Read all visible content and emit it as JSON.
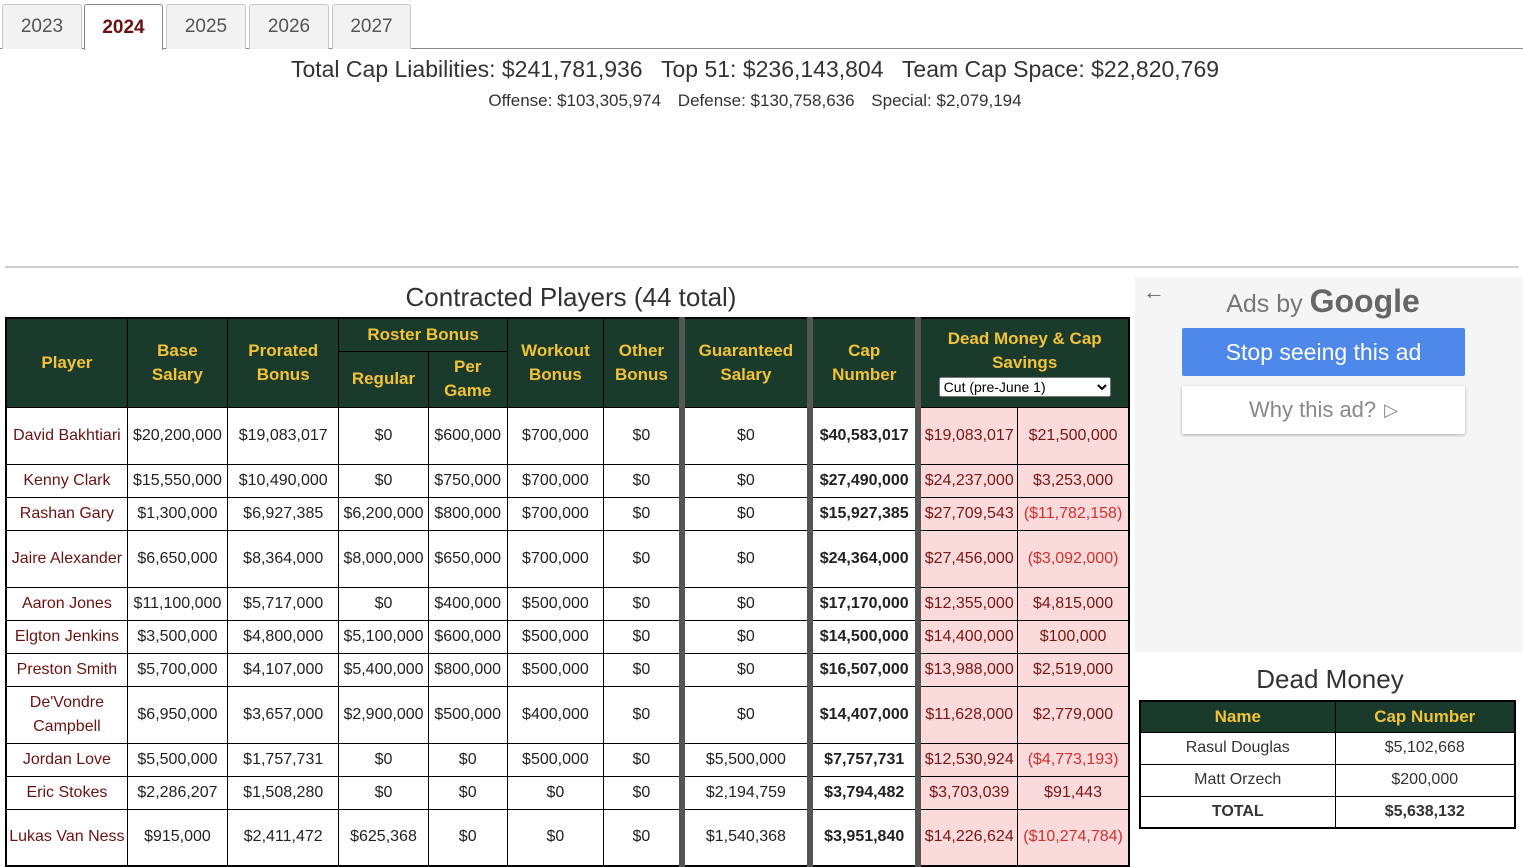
{
  "tabs": [
    {
      "label": "2023",
      "active": false
    },
    {
      "label": "2024",
      "active": true
    },
    {
      "label": "2025",
      "active": false
    },
    {
      "label": "2026",
      "active": false
    },
    {
      "label": "2027",
      "active": false
    }
  ],
  "summary": {
    "total_cap_liabilities": "Total Cap Liabilities: $241,781,936",
    "top_51": "Top 51: $236,143,804",
    "team_cap_space": "Team Cap Space: $22,820,769",
    "offense": "Offense: $103,305,974",
    "defense": "Defense: $130,758,636",
    "special": "Special: $2,079,194"
  },
  "contracted": {
    "title": "Contracted Players (44 total)",
    "headers": {
      "player": "Player",
      "base_salary": "Base Salary",
      "prorated_bonus": "Prorated Bonus",
      "roster_bonus": "Roster Bonus",
      "regular": "Regular",
      "per_game": "Per Game",
      "workout_bonus": "Workout Bonus",
      "other_bonus": "Other Bonus",
      "guaranteed_salary": "Guaranteed Salary",
      "cap_number": "Cap Number",
      "dead_money_cap_savings": "Dead Money & Cap Savings",
      "cut_select": "Cut (pre-June 1)"
    },
    "rows": [
      {
        "player": "David Bakhtiari",
        "base": "$20,200,000",
        "prorated": "$19,083,017",
        "regular": "$0",
        "per_game": "$600,000",
        "workout": "$700,000",
        "other": "$0",
        "guaranteed": "$0",
        "cap": "$40,583,017",
        "dead": "$19,083,017",
        "savings": "$21,500,000",
        "neg": false
      },
      {
        "player": "Kenny Clark",
        "base": "$15,550,000",
        "prorated": "$10,490,000",
        "regular": "$0",
        "per_game": "$750,000",
        "workout": "$700,000",
        "other": "$0",
        "guaranteed": "$0",
        "cap": "$27,490,000",
        "dead": "$24,237,000",
        "savings": "$3,253,000",
        "neg": false
      },
      {
        "player": "Rashan Gary",
        "base": "$1,300,000",
        "prorated": "$6,927,385",
        "regular": "$6,200,000",
        "per_game": "$800,000",
        "workout": "$700,000",
        "other": "$0",
        "guaranteed": "$0",
        "cap": "$15,927,385",
        "dead": "$27,709,543",
        "savings": "($11,782,158)",
        "neg": true
      },
      {
        "player": "Jaire Alexander",
        "base": "$6,650,000",
        "prorated": "$8,364,000",
        "regular": "$8,000,000",
        "per_game": "$650,000",
        "workout": "$700,000",
        "other": "$0",
        "guaranteed": "$0",
        "cap": "$24,364,000",
        "dead": "$27,456,000",
        "savings": "($3,092,000)",
        "neg": true
      },
      {
        "player": "Aaron Jones",
        "base": "$11,100,000",
        "prorated": "$5,717,000",
        "regular": "$0",
        "per_game": "$400,000",
        "workout": "$500,000",
        "other": "$0",
        "guaranteed": "$0",
        "cap": "$17,170,000",
        "dead": "$12,355,000",
        "savings": "$4,815,000",
        "neg": false
      },
      {
        "player": "Elgton Jenkins",
        "base": "$3,500,000",
        "prorated": "$4,800,000",
        "regular": "$5,100,000",
        "per_game": "$600,000",
        "workout": "$500,000",
        "other": "$0",
        "guaranteed": "$0",
        "cap": "$14,500,000",
        "dead": "$14,400,000",
        "savings": "$100,000",
        "neg": false
      },
      {
        "player": "Preston Smith",
        "base": "$5,700,000",
        "prorated": "$4,107,000",
        "regular": "$5,400,000",
        "per_game": "$800,000",
        "workout": "$500,000",
        "other": "$0",
        "guaranteed": "$0",
        "cap": "$16,507,000",
        "dead": "$13,988,000",
        "savings": "$2,519,000",
        "neg": false
      },
      {
        "player": "De'Vondre Campbell",
        "base": "$6,950,000",
        "prorated": "$3,657,000",
        "regular": "$2,900,000",
        "per_game": "$500,000",
        "workout": "$400,000",
        "other": "$0",
        "guaranteed": "$0",
        "cap": "$14,407,000",
        "dead": "$11,628,000",
        "savings": "$2,779,000",
        "neg": false
      },
      {
        "player": "Jordan Love",
        "base": "$5,500,000",
        "prorated": "$1,757,731",
        "regular": "$0",
        "per_game": "$0",
        "workout": "$500,000",
        "other": "$0",
        "guaranteed": "$5,500,000",
        "cap": "$7,757,731",
        "dead": "$12,530,924",
        "savings": "($4,773,193)",
        "neg": true
      },
      {
        "player": "Eric Stokes",
        "base": "$2,286,207",
        "prorated": "$1,508,280",
        "regular": "$0",
        "per_game": "$0",
        "workout": "$0",
        "other": "$0",
        "guaranteed": "$2,194,759",
        "cap": "$3,794,482",
        "dead": "$3,703,039",
        "savings": "$91,443",
        "neg": false
      },
      {
        "player": "Lukas Van Ness",
        "base": "$915,000",
        "prorated": "$2,411,472",
        "regular": "$625,368",
        "per_game": "$0",
        "workout": "$0",
        "other": "$0",
        "guaranteed": "$1,540,368",
        "cap": "$3,951,840",
        "dead": "$14,226,624",
        "savings": "($10,274,784)",
        "neg": true
      }
    ]
  },
  "ad": {
    "back_icon": "back-arrow-icon",
    "ads_by": "Ads by",
    "google": "Google",
    "stop_label": "Stop seeing this ad",
    "why_label": "Why this ad?",
    "why_icon": "adchoices-icon"
  },
  "dead_money": {
    "title": "Dead Money",
    "headers": {
      "name": "Name",
      "cap_number": "Cap Number"
    },
    "rows": [
      {
        "name": "Rasul Douglas",
        "cap": "$5,102,668"
      },
      {
        "name": "Matt Orzech",
        "cap": "$200,000"
      },
      {
        "name": "TOTAL",
        "cap": "$5,638,132"
      }
    ]
  },
  "colors": {
    "header_bg": "#1a3a2b",
    "header_text": "#f2c33a",
    "player_link": "#6b1212",
    "dead_bg": "#fadadb",
    "negative": "#d03030",
    "ad_button": "#4d88ea"
  }
}
